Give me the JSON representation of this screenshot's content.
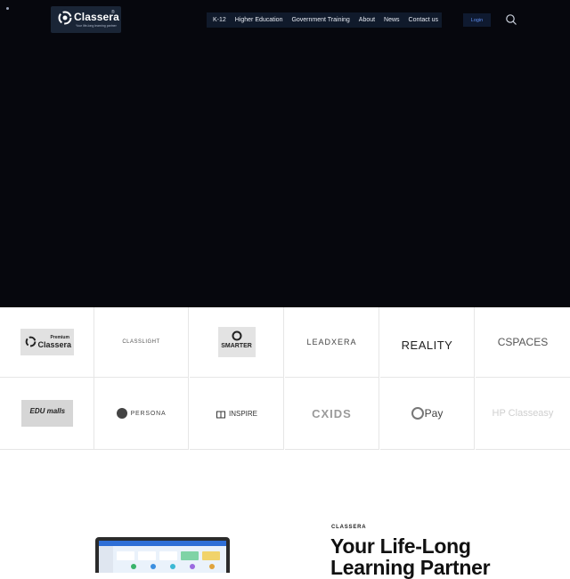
{
  "brand": {
    "name": "Classera",
    "registered": "®",
    "tagline": "Your life-long learning partner"
  },
  "nav": {
    "items": [
      "K-12",
      "Higher Education",
      "Government Training",
      "About",
      "News",
      "Contact us"
    ],
    "login_label": "Login"
  },
  "partners": [
    {
      "label": "Classera",
      "sub": "Premium"
    },
    {
      "label": "CLASSLIGHT"
    },
    {
      "label": "SMARTER"
    },
    {
      "label": "LEADXERA"
    },
    {
      "label": "REALITY"
    },
    {
      "label": "CSPACES"
    },
    {
      "label": "EDU malls"
    },
    {
      "label": "PERSONA"
    },
    {
      "label": "INSPIRE"
    },
    {
      "label": "CXIDS"
    },
    {
      "label": "Pay"
    },
    {
      "label": "HP Classeasy"
    }
  ],
  "intro": {
    "eyebrow": "CLASSERA",
    "headline_line1": "Your Life-Long",
    "headline_line2": "Learning Partner"
  },
  "colors": {
    "hero_bg": "#06070d",
    "nav_bg": "#101a2b",
    "accent": "#2f6fd6"
  }
}
